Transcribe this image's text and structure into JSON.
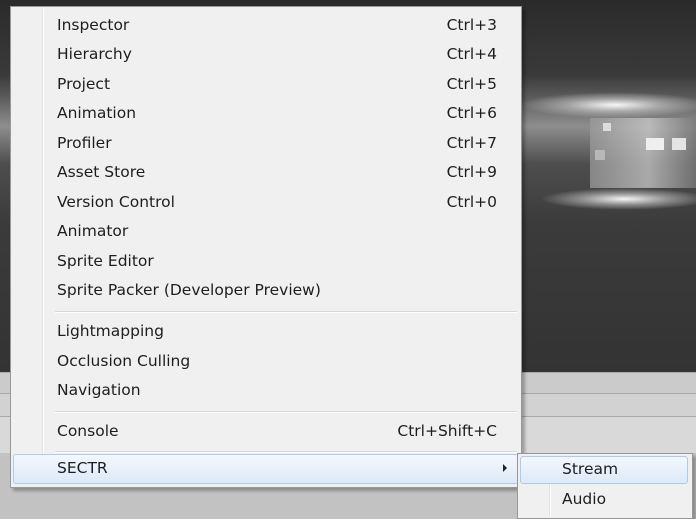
{
  "window_menu": {
    "items": [
      {
        "label": "Inspector",
        "shortcut": "Ctrl+3"
      },
      {
        "label": "Hierarchy",
        "shortcut": "Ctrl+4"
      },
      {
        "label": "Project",
        "shortcut": "Ctrl+5"
      },
      {
        "label": "Animation",
        "shortcut": "Ctrl+6"
      },
      {
        "label": "Profiler",
        "shortcut": "Ctrl+7"
      },
      {
        "label": "Asset Store",
        "shortcut": "Ctrl+9"
      },
      {
        "label": "Version Control",
        "shortcut": "Ctrl+0"
      },
      {
        "label": "Animator",
        "shortcut": ""
      },
      {
        "label": "Sprite Editor",
        "shortcut": ""
      },
      {
        "label": "Sprite Packer (Developer Preview)",
        "shortcut": ""
      },
      {
        "label": "Lightmapping",
        "shortcut": ""
      },
      {
        "label": "Occlusion Culling",
        "shortcut": ""
      },
      {
        "label": "Navigation",
        "shortcut": ""
      },
      {
        "label": "Console",
        "shortcut": "Ctrl+Shift+C"
      },
      {
        "label": "SECTR",
        "shortcut": "",
        "has_submenu": true,
        "highlighted": true
      }
    ]
  },
  "sectr_submenu": {
    "items": [
      {
        "label": "Stream",
        "highlighted": true
      },
      {
        "label": "Audio",
        "highlighted": false
      }
    ]
  },
  "colors": {
    "menu_background": "#f0f0f0",
    "highlight_background": "#dce9f8",
    "highlight_border": "#aecbec",
    "text": "#1e1e1e"
  },
  "icons": {
    "submenu_arrow": "chevron-right-icon"
  }
}
